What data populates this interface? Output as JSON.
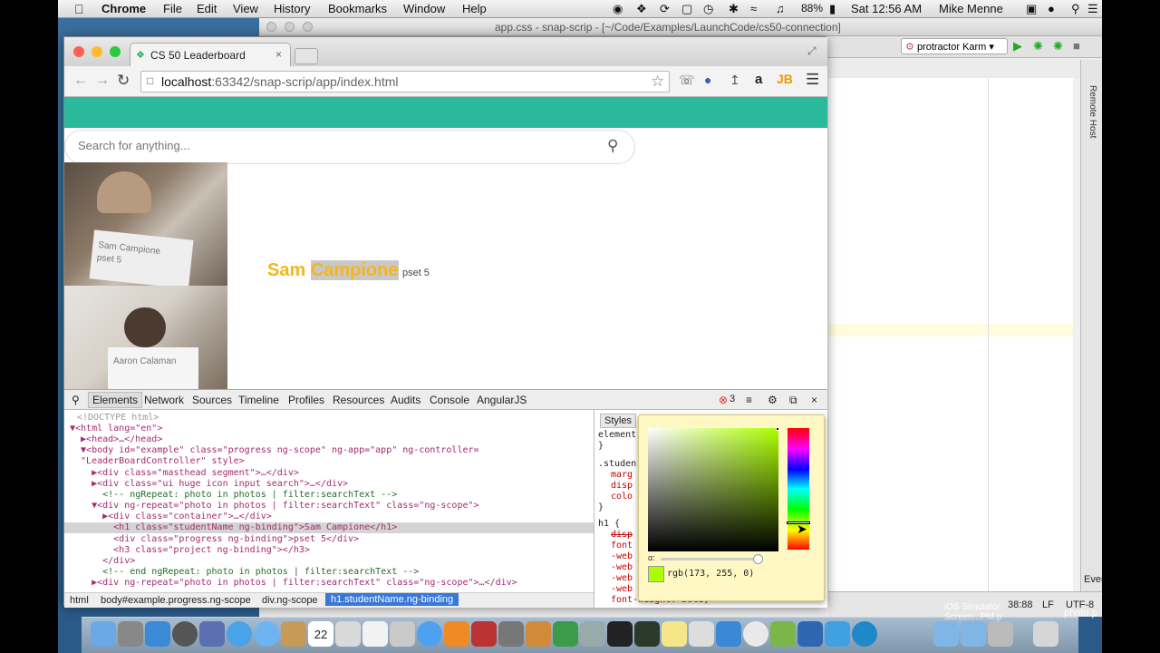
{
  "menubar": {
    "apple": "",
    "app_name": "Chrome",
    "items": [
      "File",
      "Edit",
      "View",
      "History",
      "Bookmarks",
      "Window",
      "Help"
    ],
    "battery": "88%",
    "clock": "Sat 12:56 AM",
    "user": "Mike Menne"
  },
  "ide": {
    "title": "app.css - snap-scrip - [~/Code/Examples/LaunchCode/cs50-connection]",
    "run_config": "protractor Karm",
    "side_tab": "Remote Host",
    "event_log": "Event Log",
    "cursor_pos": "38:88",
    "line_sep": "LF",
    "encoding": "UTF-8",
    "simulator_label": "iOS Simulator",
    "simulator_sub": "Screen...PM.p",
    "photo_label": "photo.p"
  },
  "browser": {
    "tab_title": "CS 50 Leaderboard",
    "url_host": "localhost",
    "url_path": ":63342/snap-scrip/app/index.html"
  },
  "page": {
    "search_placeholder": "Search for anything...",
    "student_first": "Sam ",
    "student_last": "Campione",
    "progress": "pset 5",
    "photo1_caption": "Sam Campione\npset 5",
    "photo2_caption": "Aaron Calaman"
  },
  "devtools": {
    "tabs": [
      "Elements",
      "Network",
      "Sources",
      "Timeline",
      "Profiles",
      "Resources",
      "Audits",
      "Console",
      "AngularJS"
    ],
    "error_count": "3",
    "dom_lines": [
      "<!DOCTYPE html>",
      "▼<html lang=\"en\">",
      "  ▶<head>…</head>",
      "  ▼<body id=\"example\" class=\"progress ng-scope\" ng-app=\"app\" ng-controller=",
      "  \"LeaderBoardController\" style>",
      "    ▶<div class=\"masthead segment\">…</div>",
      "    ▶<div class=\"ui huge icon input search\">…</div>",
      "      <!-- ngRepeat: photo in photos | filter:searchText -->",
      "    ▼<div ng-repeat=\"photo in photos | filter:searchText\" class=\"ng-scope\">",
      "      ▶<div class=\"container\">…</div>",
      "        <h1 class=\"studentName ng-binding\">Sam Campione</h1>",
      "        <div class=\"progress ng-binding\">pset 5</div>",
      "        <h3 class=\"project ng-binding\"></h3>",
      "      </div>",
      "      <!-- end ngRepeat: photo in photos | filter:searchText -->",
      "    ▶<div ng-repeat=\"photo in photos | filter:searchText\" class=\"ng-scope\">…</div>"
    ],
    "crumbs": [
      "html",
      "body#example.progress.ng-scope",
      "div.ng-scope",
      "h1.studentName.ng-binding"
    ],
    "styles_tab": "Styles",
    "styles_lines": [
      "element",
      "}",
      ".studen",
      "marg",
      "disp",
      "colo",
      "}",
      "h1 {",
      "disp",
      "font",
      "-web",
      "-web",
      "-web",
      "-web",
      "font-weight: bold;"
    ]
  },
  "picker": {
    "alpha_label": "α:",
    "value": "rgb(173, 255, 0)",
    "swatch": "#adff00"
  },
  "dock": {
    "calendar_day": "22"
  }
}
